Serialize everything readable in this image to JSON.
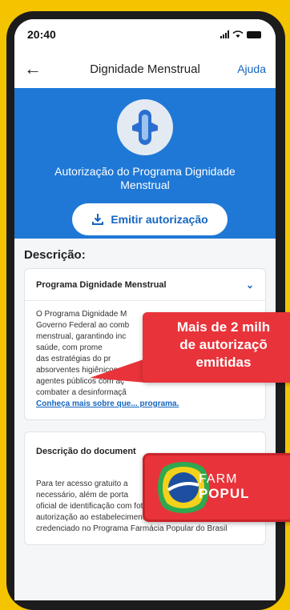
{
  "status_bar": {
    "time": "20:40"
  },
  "header": {
    "title": "Dignidade Menstrual",
    "help_label": "Ajuda"
  },
  "hero": {
    "title": "Autorização do Programa Dignidade Menstrual",
    "button_label": "Emitir autorização"
  },
  "description": {
    "heading": "Descrição:",
    "card1": {
      "title": "Programa Dignidade Menstrual",
      "lines": [
        "O Programa Dignidade M",
        "Governo Federal ao comb",
        "menstrual, garantindo inc",
        "saúde, com prome",
        "das estratégias do pr",
        "absorventes higiênicos, a",
        "agentes públicos com aç",
        "combater a desinformaçã"
      ],
      "link_text": "Conheça mais sobre que... programa."
    },
    "card2": {
      "title": "Descrição do document",
      "lines": [
        "Para ter acesso gratuito a",
        "necessário, além de porta",
        "oficial de identificação com foto, apresentar",
        "autorização ao estabelecimento farmacêutico",
        "credenciado no Programa Farmácia Popular do Brasil"
      ]
    }
  },
  "overlay": {
    "bubble_lines": [
      "Mais de 2 milh",
      "de autorizaçõ",
      "emitidas"
    ],
    "badge_line1": "FARM",
    "badge_line2": "POPUL"
  },
  "colors": {
    "brand_blue": "#1f78d6",
    "overlay_red": "#e8333a",
    "background": "#f5c400"
  }
}
